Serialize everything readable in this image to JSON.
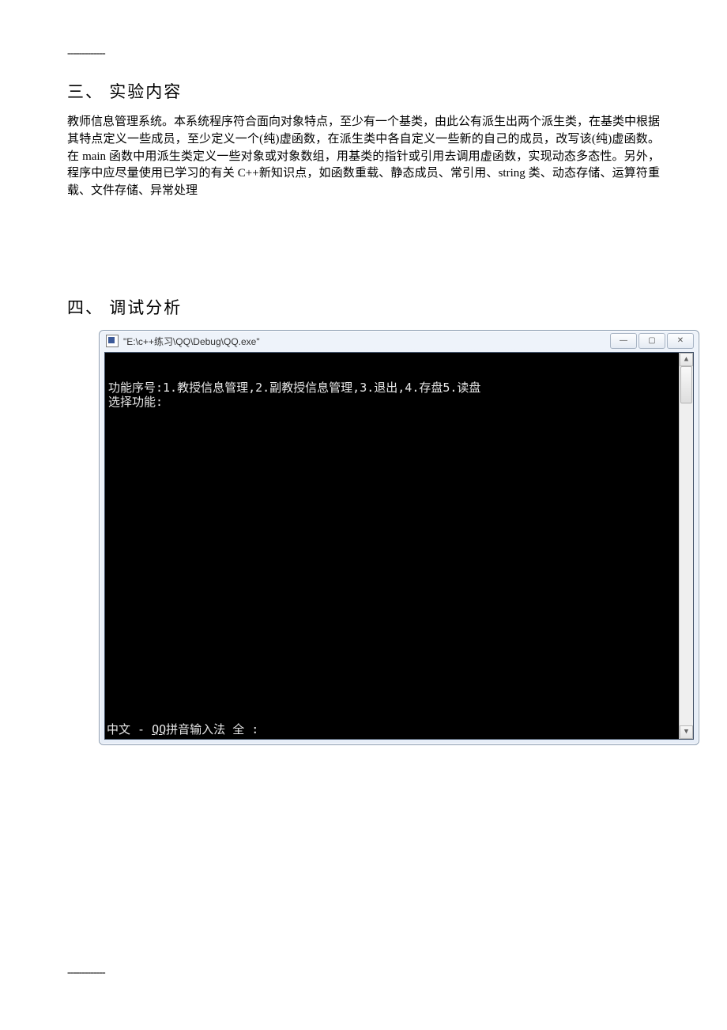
{
  "marks": {
    "top_dash": "-------------",
    "bottom_dash": "-------------"
  },
  "section3": {
    "heading": "三、 实验内容",
    "body": "教师信息管理系统。本系统程序符合面向对象特点，至少有一个基类，由此公有派生出两个派生类，在基类中根据其特点定义一些成员，至少定义一个(纯)虚函数，在派生类中各自定义一些新的自己的成员，改写该(纯)虚函数。在 main 函数中用派生类定义一些对象或对象数组，用基类的指针或引用去调用虚函数，实现动态多态性。另外，程序中应尽量使用已学习的有关 C++新知识点，如函数重载、静态成员、常引用、string 类、动态存储、运算符重载、文件存储、异常处理"
  },
  "section4": {
    "heading": "四、 调试分析"
  },
  "console": {
    "title": "\"E:\\c++练习\\QQ\\Debug\\QQ.exe\"",
    "line1": "功能序号:1.教授信息管理,2.副教授信息管理,3.退出,4.存盘5.读盘",
    "line2": "选择功能:",
    "ime_prefix": "中文 - ",
    "ime_q": "QQ",
    "ime_suffix": "拼音输入法 全 :",
    "controls": {
      "min": "—",
      "max": "▢",
      "close": "✕"
    },
    "scroll": {
      "up": "▲",
      "down": "▼"
    }
  }
}
